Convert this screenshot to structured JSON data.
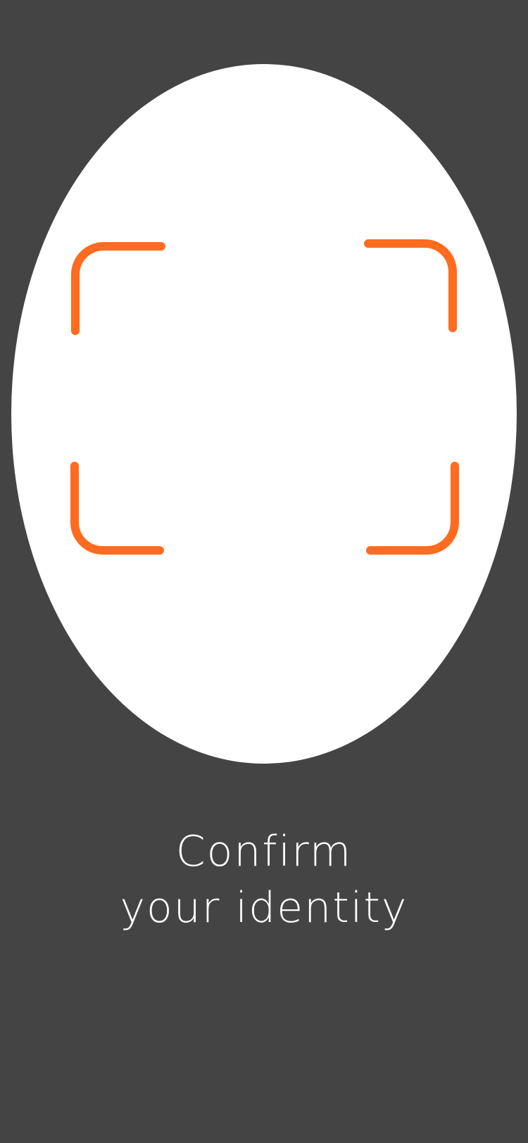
{
  "prompt": {
    "line1": "Confirm",
    "line2": "your identity"
  },
  "colors": {
    "background": "#444444",
    "oval": "#ffffff",
    "frame_accent": "#FF6B1F",
    "text": "#ffffff"
  },
  "icons": {
    "frame_corners": "face-scan-frame-icon"
  }
}
